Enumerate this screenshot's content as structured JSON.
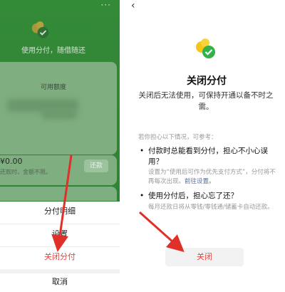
{
  "left": {
    "more_glyph": "···",
    "slogan": "使用分付，随借随还",
    "credit_title": "可用额度",
    "amount": "¥0.00",
    "amount_prefix": "¥",
    "hint": "还款时，金额不限。",
    "repay_label": "还款",
    "sheet": {
      "items": [
        "分付明细",
        "设置",
        "关闭分付"
      ],
      "cancel": "取消"
    }
  },
  "right": {
    "back_glyph": "‹",
    "title": "关闭分付",
    "description": "关闭后无法使用，可保持开通以备不时之需。",
    "subhead": "若你担心以下情况，可参考：",
    "q1": "付款时总能看到分付，担心不小心误用？",
    "a1_text": "设置为“使用后可作为优先支付方式”，分付将不再每次出现。",
    "a1_link": "前往设置。",
    "q2": "使用分付后，担心忘了还？",
    "a2": "每月还款日将从零钱/零钱通/储蓄卡自动还款。",
    "close_label": "关闭"
  },
  "colors": {
    "brand_green": "#338a37",
    "danger_red": "#e64340",
    "annotation_arrow": "#e0302a",
    "link_blue": "#576b95",
    "logo_yellow": "#f5c518",
    "logo_green": "#34b24a"
  },
  "icons": {
    "logo": "fenfu-logo-icon",
    "back": "back-chevron-icon",
    "more": "more-icon"
  }
}
